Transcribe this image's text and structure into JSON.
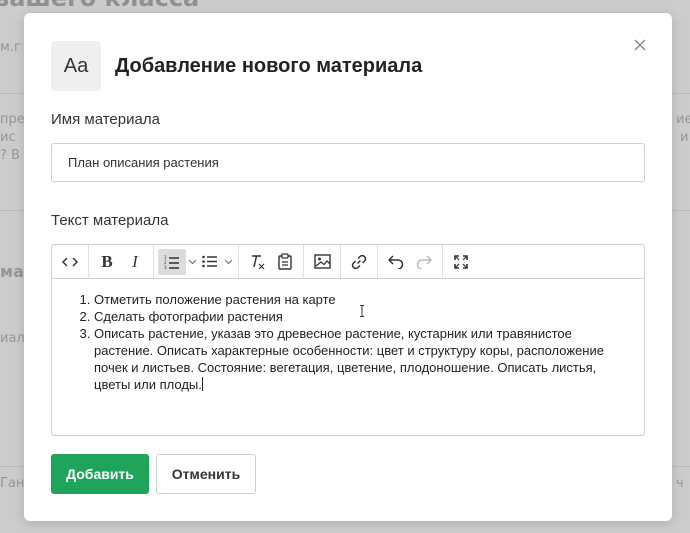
{
  "background": {
    "title_fragment": "вашего класса",
    "fragments": [
      "м.г",
      "пред",
      "ис",
      "? В",
      "ма",
      "иал",
      "Гант",
      "ие",
      "и",
      "ч"
    ]
  },
  "modal": {
    "icon_text": "Aa",
    "title": "Добавление нового материала",
    "close_icon": "close-icon",
    "name_label": "Имя материала",
    "name_value": "План описания растения",
    "text_label": "Текст материала",
    "toolbar": {
      "bold": "B",
      "italic": "I",
      "icons": [
        "code-icon",
        "bold-icon",
        "italic-icon",
        "numbered-list-icon",
        "bulleted-list-icon",
        "clear-format-icon",
        "paste-icon",
        "image-icon",
        "link-icon",
        "undo-icon",
        "redo-icon",
        "fullscreen-icon"
      ],
      "active": "numbered-list"
    },
    "content_items": [
      "Отметить положение растения на карте",
      "Сделать фотографии растения",
      "Описать растение, указав это древесное растение, кустарник или травянистое растение. Описать характерные особенности: цвет и структуру коры, расположение почек и листьев. Состояние: вегетация, цветение, плодоношение. Описать листья, цветы или плоды."
    ],
    "add_button": "Добавить",
    "cancel_button": "Отменить",
    "colors": {
      "primary": "#1fa55b",
      "border": "#cfcfcf",
      "active_tool": "#dcdcdc"
    }
  }
}
